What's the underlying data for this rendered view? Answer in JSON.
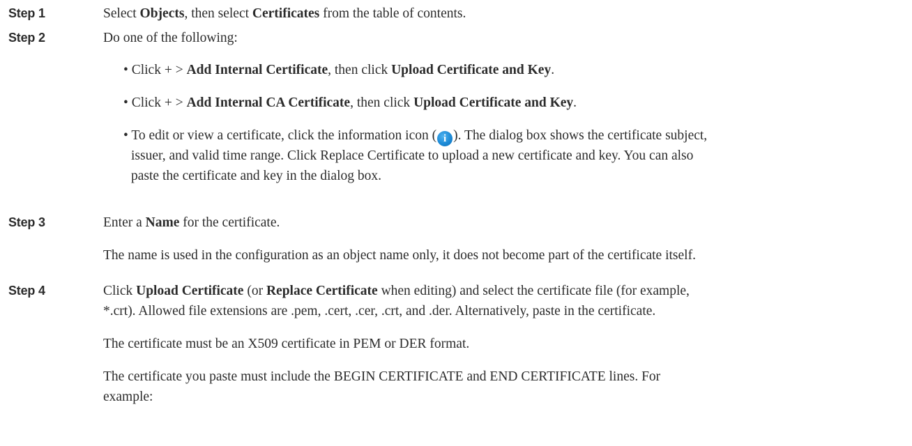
{
  "steps": [
    {
      "label": "Step 1",
      "lines": [
        {
          "t1": "Select ",
          "b1": "Objects",
          "t2": ", then select ",
          "b2": "Certificates",
          "t3": " from the table of contents."
        }
      ]
    },
    {
      "label": "Step 2",
      "intro": "Do one of the following:",
      "bullets": [
        {
          "t1": "• Click + > ",
          "b1": "Add Internal Certificate",
          "t2": ", then click ",
          "b2": "Upload Certificate and Key",
          "t3": "."
        },
        {
          "t1": "• Click + > ",
          "b1": "Add Internal CA Certificate",
          "t2": ", then click ",
          "b2": "Upload Certificate and Key",
          "t3": "."
        }
      ],
      "bullet3": {
        "line1_pre": "• To edit or view a certificate, click the information icon (",
        "icon": "info-icon",
        "icon_glyph": "i",
        "line1_post": "). The dialog box shows the certificate subject,",
        "line2": "issuer, and valid time range. Click Replace Certificate to upload a new certificate and key. You can also",
        "line3": "paste the certificate and key in the dialog box."
      }
    },
    {
      "label": "Step 3",
      "line_pre": "Enter a ",
      "line_bold": "Name",
      "line_post": " for the certificate.",
      "note": "The name is used in the configuration as an object name only, it does not become part of the certificate itself."
    },
    {
      "label": "Step 4",
      "l1_t1": "Click ",
      "l1_b1": "Upload Certificate",
      "l1_t2": " (or ",
      "l1_b2": "Replace Certificate",
      "l1_t3": " when editing) and select the certificate file (for example,",
      "l2": "*.crt). Allowed file extensions are .pem, .cert, .cer, .crt, and .der. Alternatively, paste in the certificate.",
      "p2": "The certificate must be an X509 certificate in PEM or DER format.",
      "p3_l1": "The certificate you paste must include the BEGIN CERTIFICATE and END CERTIFICATE lines. For",
      "p3_l2": "example:"
    }
  ]
}
